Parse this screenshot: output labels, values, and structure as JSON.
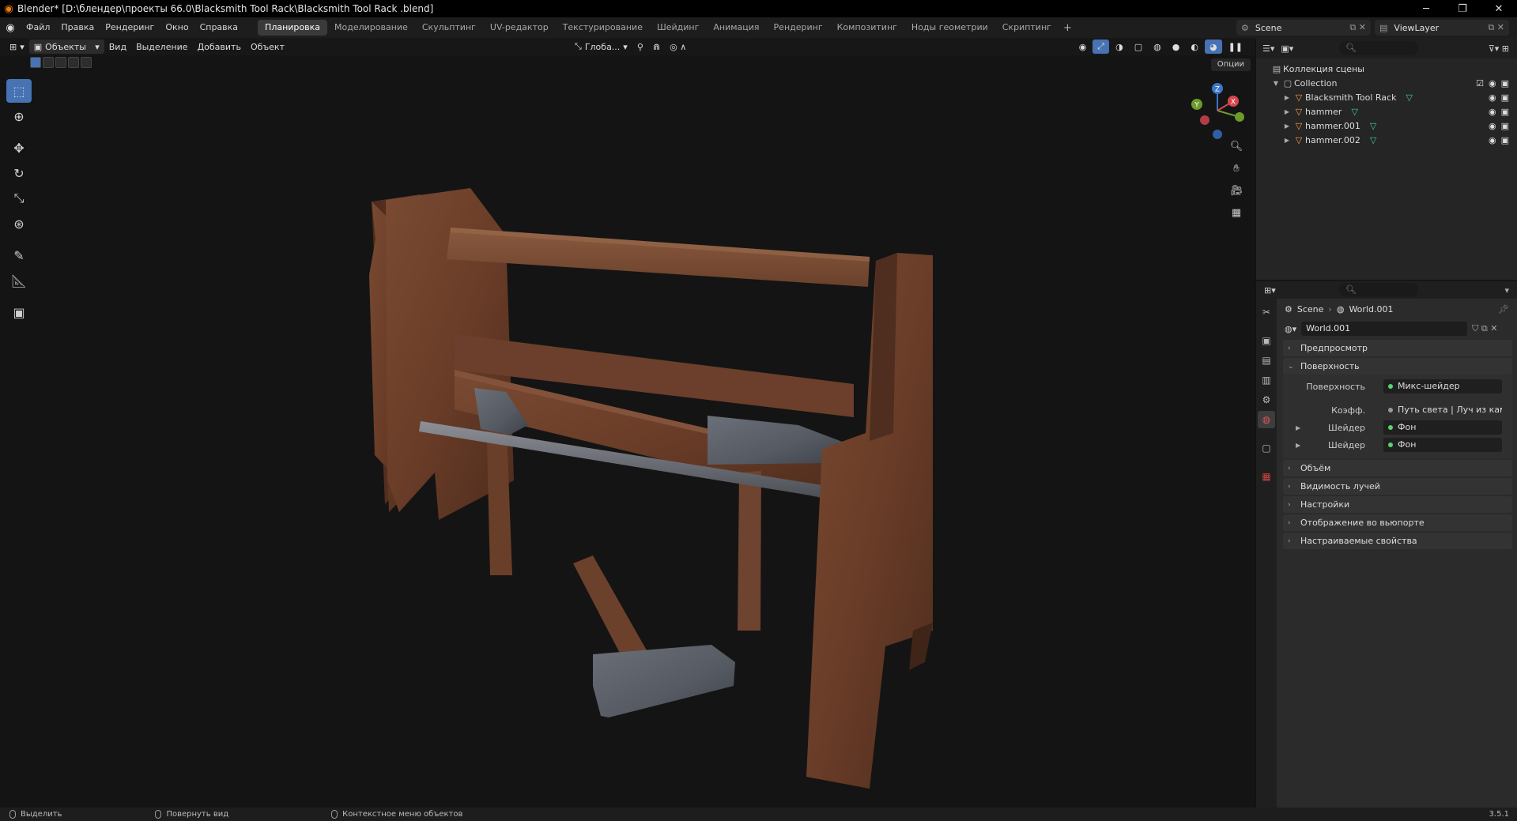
{
  "window": {
    "title": "Blender* [D:\\блендер\\проекты 66.0\\Blacksmith Tool Rack\\Blacksmith Tool Rack .blend]",
    "minimize_glyph": "─",
    "maximize_glyph": "❐",
    "close_glyph": "✕"
  },
  "menu": [
    "Файл",
    "Правка",
    "Рендеринг",
    "Окно",
    "Справка"
  ],
  "workspaces": [
    "Планировка",
    "Моделирование",
    "Скульптинг",
    "UV-редактор",
    "Текстурирование",
    "Шейдинг",
    "Анимация",
    "Рендеринг",
    "Композитинг",
    "Ноды геометрии",
    "Скриптинг"
  ],
  "active_workspace": "Планировка",
  "scene": {
    "name": "Scene"
  },
  "view_layer": {
    "name": "ViewLayer"
  },
  "viewport": {
    "mode": "Объекты",
    "menu": [
      "Вид",
      "Выделение",
      "Добавить",
      "Объект"
    ],
    "transform_orientation": "Глоба...",
    "options": "Опции",
    "gizmo_axes": {
      "x": "X",
      "y": "Y",
      "z": "Z"
    }
  },
  "outliner": {
    "scene_collection": "Коллекция сцены",
    "collection": "Collection",
    "objects": [
      "Blacksmith Tool Rack",
      "hammer",
      "hammer.001",
      "hammer.002"
    ]
  },
  "properties": {
    "breadcrumb": [
      "Scene",
      "World.001"
    ],
    "world_name": "World.001",
    "panels_top": [
      "Предпросмотр",
      "Поверхность"
    ],
    "surface_rows": [
      {
        "label": "Поверхность",
        "value": "Микс-шейдер"
      },
      {
        "label": "Коэфф.",
        "value": "Путь света | Луч из камеры"
      },
      {
        "label": "Шейдер",
        "value": "Фон"
      },
      {
        "label": "Шейдер",
        "value": "Фон"
      }
    ],
    "panels_bottom": [
      "Объём",
      "Видимость лучей",
      "Настройки",
      "Отображение во вьюпорте",
      "Настраиваемые свойства"
    ]
  },
  "status": {
    "left": "Выделить",
    "middle": "Повернуть вид",
    "right": "Контекстное меню объектов",
    "version": "3.5.1"
  },
  "colors": {
    "accent": "#4772b3",
    "object_icon": "#ff9b3e",
    "mesh_icon": "#39d2a0",
    "x_axis": "#d7464e",
    "y_axis": "#6b9b2a",
    "z_axis": "#3a76c8"
  }
}
